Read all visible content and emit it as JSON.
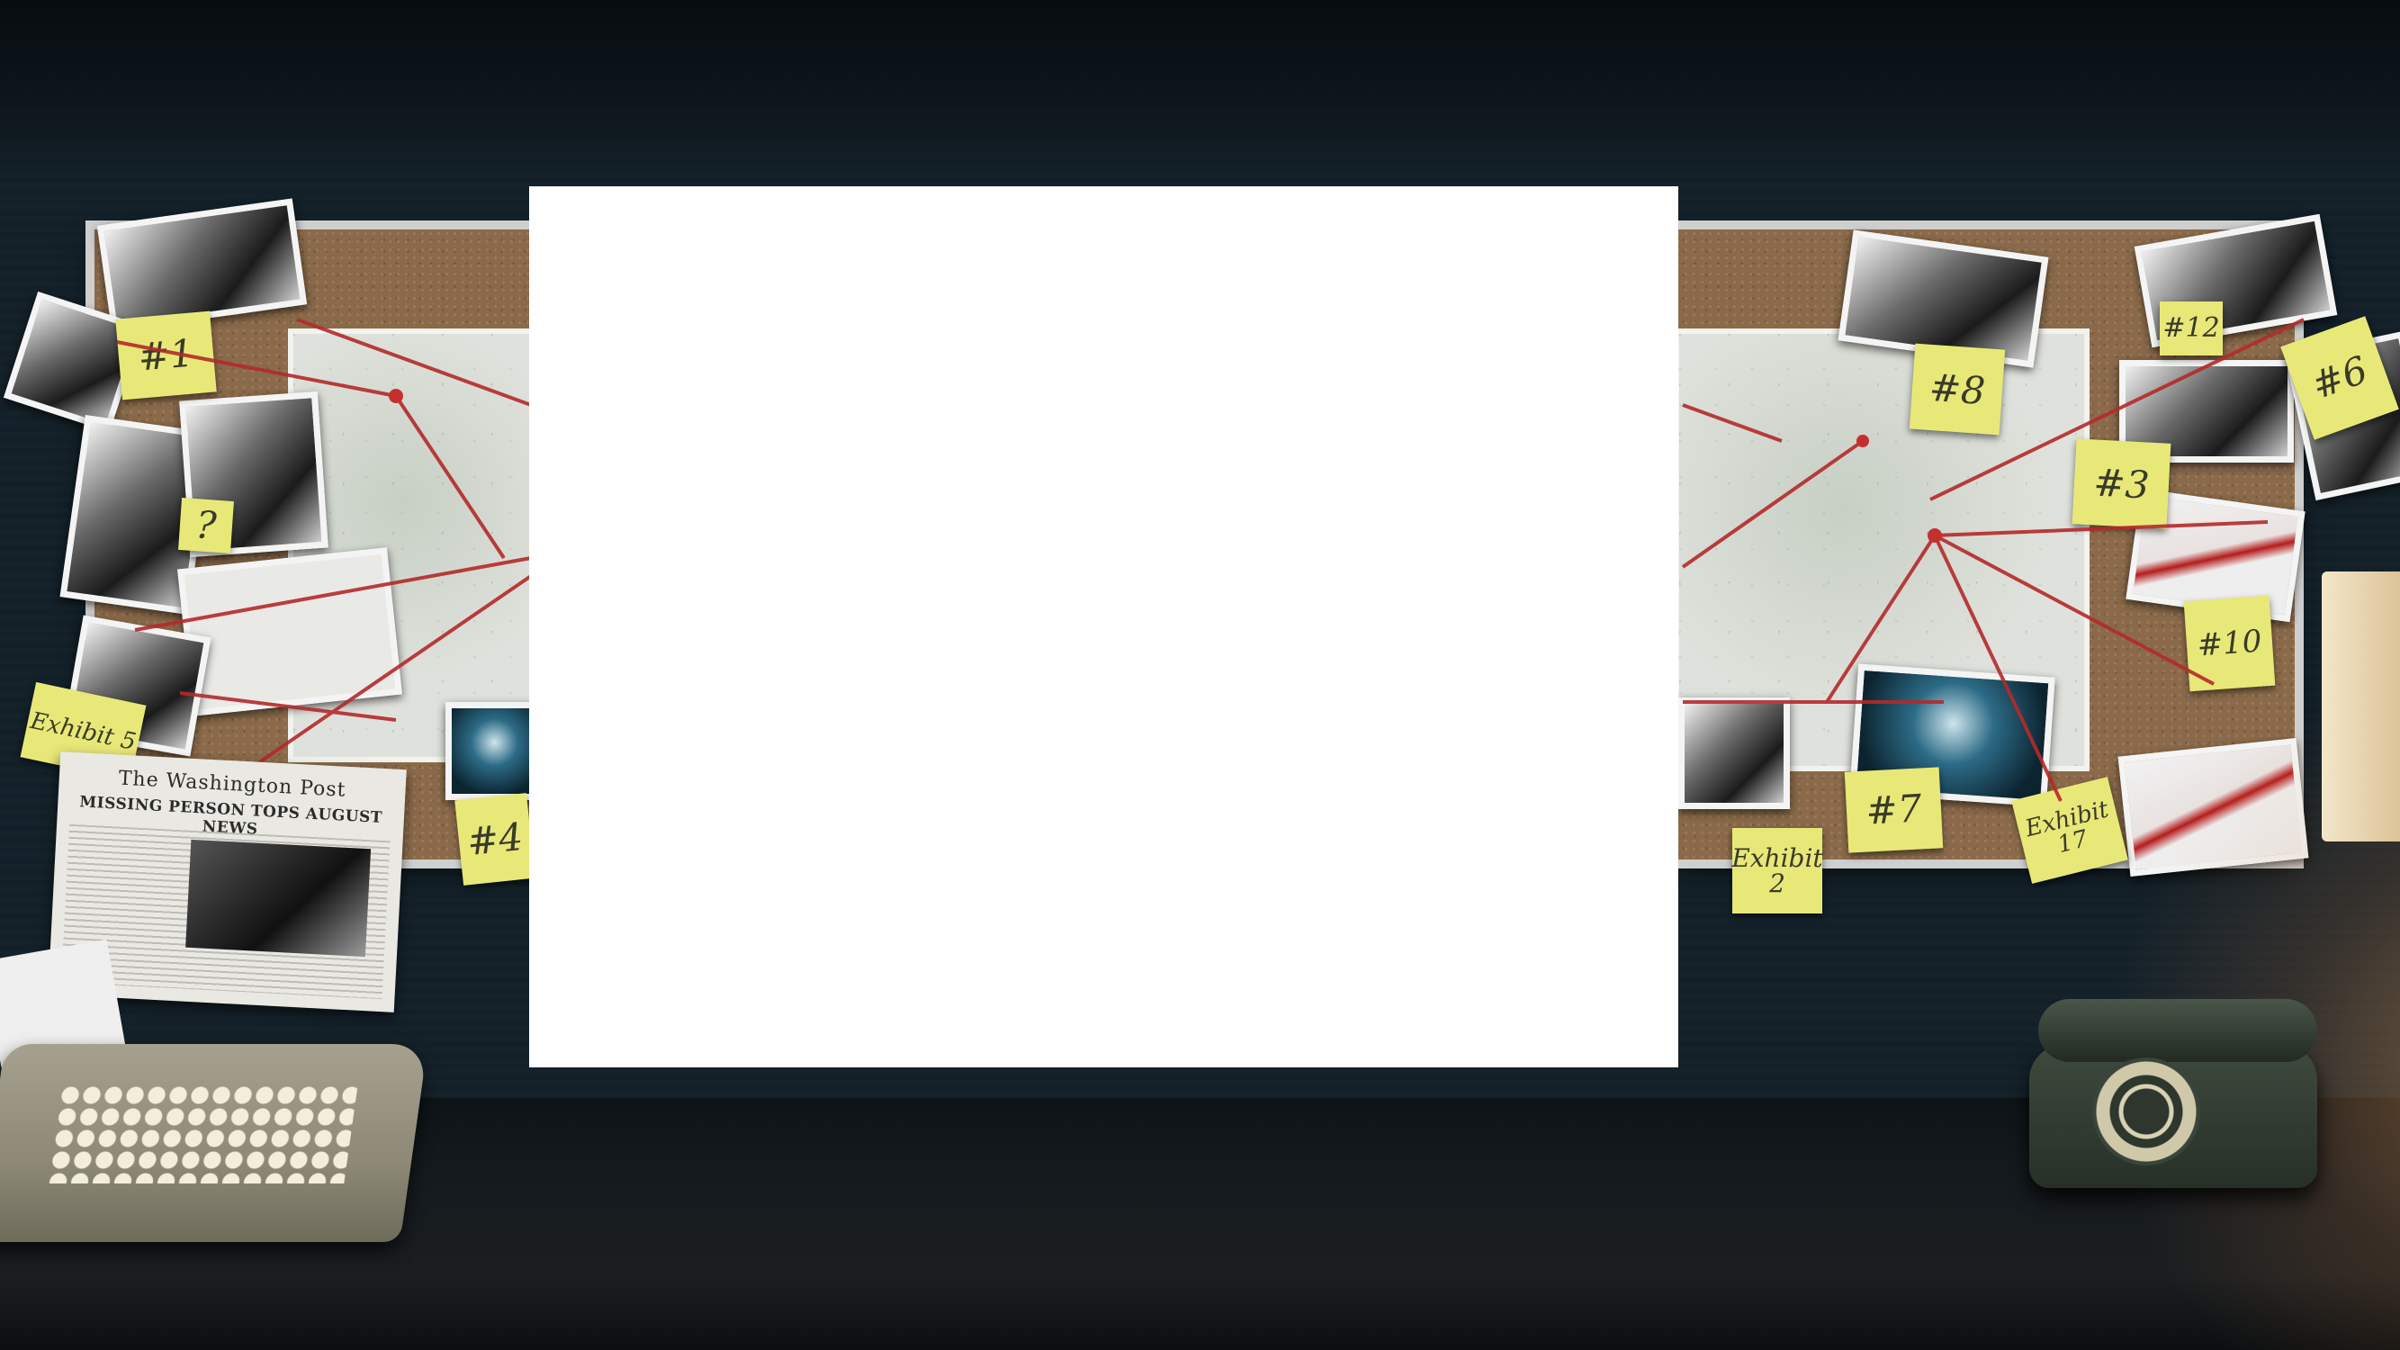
{
  "scene": {
    "description_icon": "detective-evidence-board",
    "colors": {
      "placeholder": "#ffffff",
      "string": "#b42a2a",
      "note": "#e8e878"
    }
  },
  "notes_left": [
    {
      "label": "#1"
    },
    {
      "label": "?"
    },
    {
      "label": "Exhibit 5"
    },
    {
      "label": "#4"
    }
  ],
  "notes_right": [
    {
      "label": "#8"
    },
    {
      "label": "#12"
    },
    {
      "label": "#6"
    },
    {
      "label": "#3"
    },
    {
      "label": "#10"
    },
    {
      "label": "#7"
    },
    {
      "label": "Exhibit 2"
    },
    {
      "label": "Exhibit 17"
    }
  ],
  "newspaper": {
    "masthead": "The Washington Post",
    "headline": "MISSING PERSON TOPS AUGUST NEWS"
  }
}
